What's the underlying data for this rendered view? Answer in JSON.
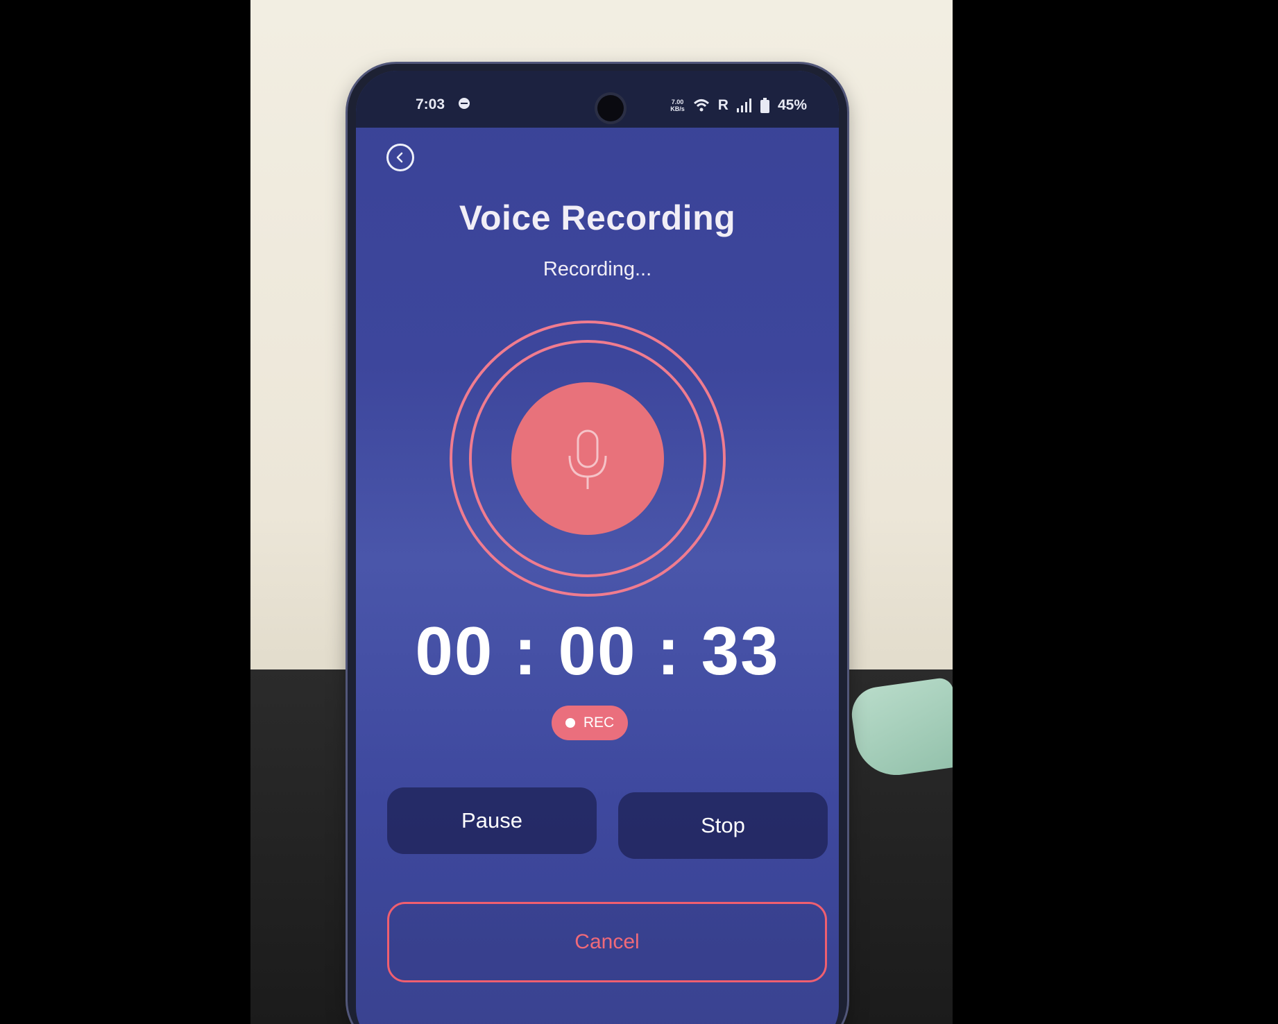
{
  "status_bar": {
    "time": "7:03",
    "network_speed_value": "7.00",
    "network_speed_unit": "KB/s",
    "roaming": "R",
    "battery": "45%"
  },
  "header": {
    "title": "Voice Recording",
    "status": "Recording..."
  },
  "recorder": {
    "elapsed": "00 : 00 : 33",
    "badge": "REC"
  },
  "controls": {
    "pause_label": "Pause",
    "stop_label": "Stop",
    "cancel_label": "Cancel"
  },
  "colors": {
    "screen_background": "#3d469c",
    "accent_red": "#e8727b",
    "ring_color": "#f07c8f",
    "button_background": "#1c2052"
  },
  "icons": [
    "back-arrow-icon",
    "microphone-icon",
    "wifi-icon",
    "signal-icon",
    "battery-icon",
    "do-not-disturb-icon"
  ]
}
